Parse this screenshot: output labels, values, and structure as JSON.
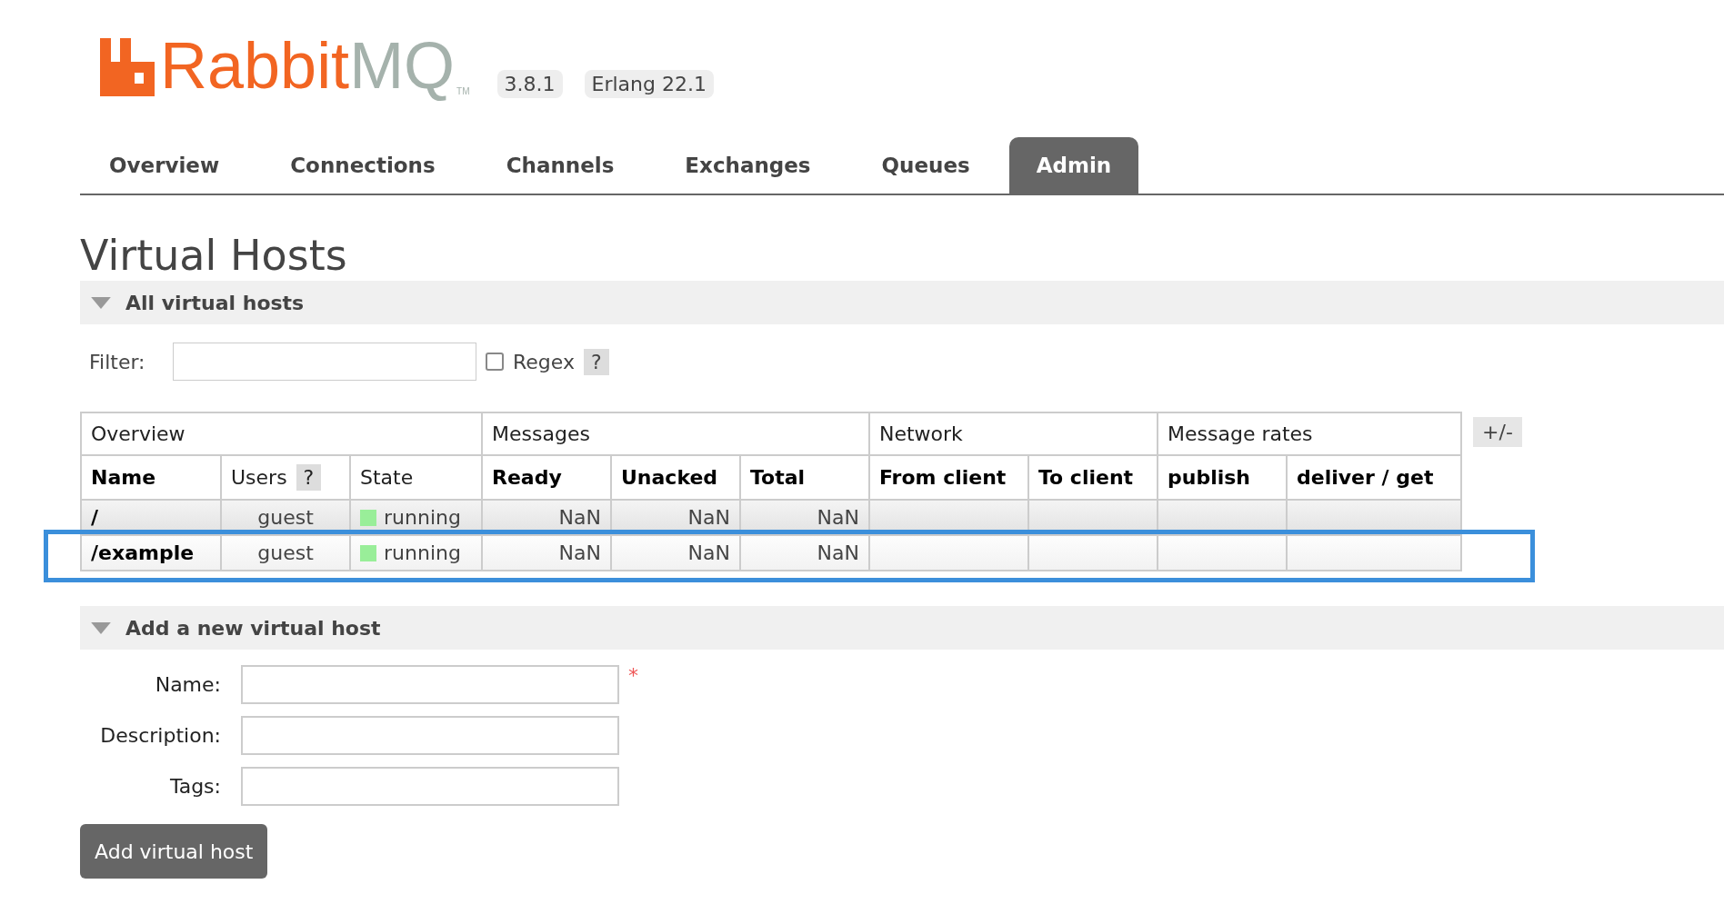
{
  "header": {
    "logo": {
      "brand": "Rabbit",
      "suffix": "MQ",
      "trademark": "TM"
    },
    "badges": [
      "3.8.1",
      "Erlang 22.1"
    ]
  },
  "tabs": [
    {
      "label": "Overview",
      "selected": false
    },
    {
      "label": "Connections",
      "selected": false
    },
    {
      "label": "Channels",
      "selected": false
    },
    {
      "label": "Exchanges",
      "selected": false
    },
    {
      "label": "Queues",
      "selected": false
    },
    {
      "label": "Admin",
      "selected": true
    }
  ],
  "page_title": "Virtual Hosts",
  "all_hosts": {
    "title": "All virtual hosts",
    "expanded": true,
    "filter_label": "Filter:",
    "regex": {
      "label": "Regex",
      "checked": false
    },
    "regex_help": "?",
    "table": {
      "groups": [
        {
          "label": "Overview",
          "columns": [
            {
              "label": "Name",
              "bold": true
            },
            {
              "label": "Users",
              "bold": false,
              "help": "?"
            },
            {
              "label": "State",
              "bold": false
            }
          ]
        },
        {
          "label": "Messages",
          "columns": [
            {
              "label": "Ready",
              "bold": true
            },
            {
              "label": "Unacked",
              "bold": true
            },
            {
              "label": "Total",
              "bold": true
            }
          ]
        },
        {
          "label": "Network",
          "columns": [
            {
              "label": "From client",
              "bold": true
            },
            {
              "label": "To client",
              "bold": true
            }
          ]
        },
        {
          "label": "Message rates",
          "columns": [
            {
              "label": "publish",
              "bold": true
            },
            {
              "label": "deliver / get",
              "bold": true
            }
          ]
        }
      ],
      "rows": [
        {
          "name": "/",
          "users": "guest",
          "state": "running",
          "color": "#99ee99",
          "ready": "NaN",
          "unacked": "NaN",
          "total": "NaN",
          "highlighted": false
        },
        {
          "name": "/example",
          "users": "guest",
          "state": "running",
          "color": "#99ee99",
          "ready": "NaN",
          "unacked": "NaN",
          "total": "NaN",
          "highlighted": true
        }
      ],
      "toggle": "+/-"
    }
  },
  "add_host": {
    "title": "Add a new virtual host",
    "expanded": true,
    "required_mark": "*",
    "fields": [
      {
        "label": "Name:",
        "required": true
      },
      {
        "label": "Description:",
        "required": false
      },
      {
        "label": "Tags:",
        "required": false
      }
    ],
    "button": "Add virtual host"
  }
}
